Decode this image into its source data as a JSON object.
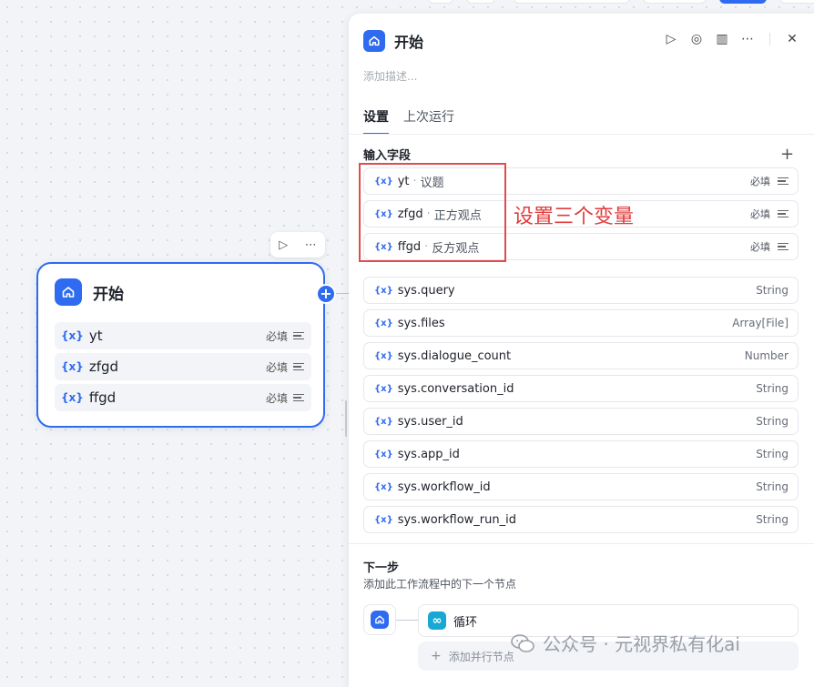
{
  "canvas_node": {
    "title": "开始",
    "actions": {
      "run_icon": "▷",
      "more_icon": "⋯"
    },
    "vars": [
      {
        "tag": "{x}",
        "name": "yt",
        "required": "必填"
      },
      {
        "tag": "{x}",
        "name": "zfgd",
        "required": "必填"
      },
      {
        "tag": "{x}",
        "name": "ffgd",
        "required": "必填"
      }
    ],
    "add_handle": "+"
  },
  "panel": {
    "title": "开始",
    "tools": {
      "run": "▷",
      "locate": "◎",
      "docs": "▥",
      "more": "⋯",
      "close": "✕"
    },
    "description_placeholder": "添加描述...",
    "tabs": [
      {
        "label": "设置",
        "active": true
      },
      {
        "label": "上次运行",
        "active": false
      }
    ],
    "input_section_title": "输入字段",
    "add_icon": "+",
    "fields": [
      {
        "tag": "{x}",
        "name": "yt",
        "label": "议题",
        "required": "必填"
      },
      {
        "tag": "{x}",
        "name": "zfgd",
        "label": "正方观点",
        "required": "必填"
      },
      {
        "tag": "{x}",
        "name": "ffgd",
        "label": "反方观点",
        "required": "必填"
      }
    ],
    "sys_vars": [
      {
        "tag": "{x}",
        "name": "sys.query",
        "type": "String"
      },
      {
        "tag": "{x}",
        "name": "sys.files",
        "type": "Array[File]"
      },
      {
        "tag": "{x}",
        "name": "sys.dialogue_count",
        "type": "Number"
      },
      {
        "tag": "{x}",
        "name": "sys.conversation_id",
        "type": "String"
      },
      {
        "tag": "{x}",
        "name": "sys.user_id",
        "type": "String"
      },
      {
        "tag": "{x}",
        "name": "sys.app_id",
        "type": "String"
      },
      {
        "tag": "{x}",
        "name": "sys.workflow_id",
        "type": "String"
      },
      {
        "tag": "{x}",
        "name": "sys.workflow_run_id",
        "type": "String"
      }
    ],
    "next_title": "下一步",
    "next_subtitle": "添加此工作流程中的下一个节点",
    "next_node": "循环",
    "add_parallel_icon": "+",
    "add_parallel": "添加并行节点"
  },
  "annotation": "设置三个变量",
  "watermark": "公众号 · 元视界私有化ai",
  "colors": {
    "accent": "#2f6bf0",
    "annotation": "#e03c3c",
    "loop": "#19a8d4"
  }
}
